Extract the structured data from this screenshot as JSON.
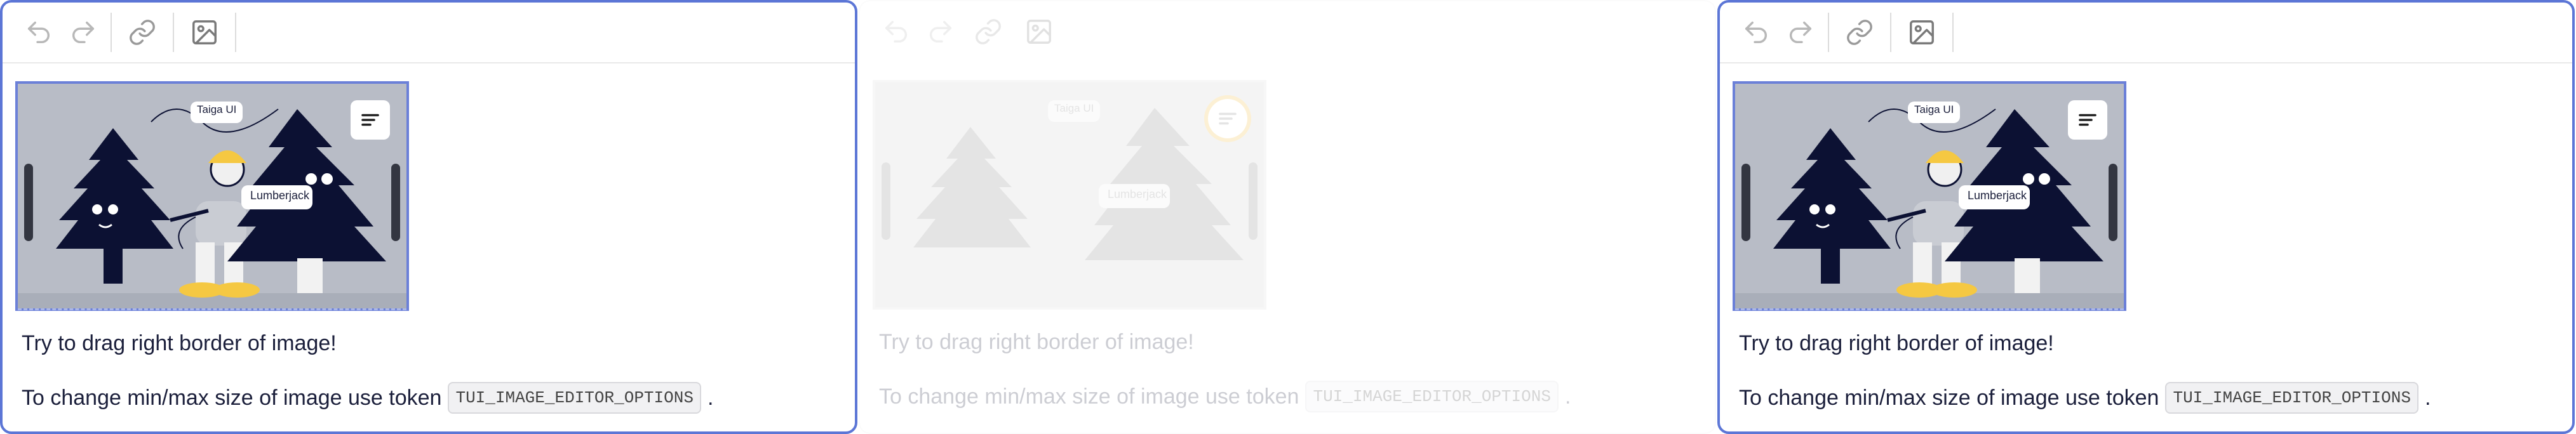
{
  "toolbar": {
    "icons": [
      "undo-icon",
      "redo-icon",
      "link-icon",
      "image-icon"
    ]
  },
  "image": {
    "label_top": "Taiga UI",
    "label_mid": "Lumberjack",
    "menu_icon": "menu-lines-icon"
  },
  "content": {
    "line1": "Try to drag right border of image!",
    "line2_prefix": "To change min/max size of image use token",
    "token": "TUI_IMAGE_EDITOR_OPTIONS",
    "line2_suffix": "."
  },
  "colors": {
    "accent": "#5c76d6",
    "image_bg": "#b8bcc6",
    "tree": "#0c1133",
    "boots": "#f5c842"
  }
}
